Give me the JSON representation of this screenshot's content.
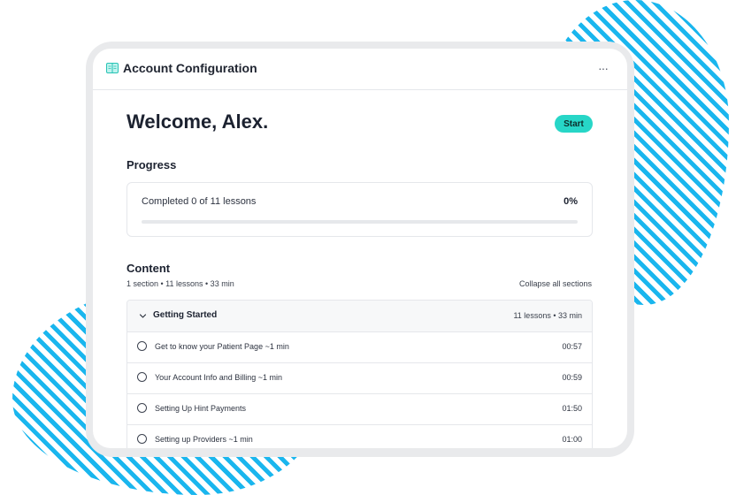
{
  "header": {
    "title": "Account Configuration",
    "book_icon": "book-icon",
    "more_icon": "more-horizontal-icon",
    "more_label": "···"
  },
  "welcome": {
    "heading": "Welcome, Alex.",
    "start_label": "Start"
  },
  "progress": {
    "heading": "Progress",
    "text": "Completed 0 of 11 lessons",
    "percent_label": "0%",
    "percent_value": 0
  },
  "content": {
    "heading": "Content",
    "meta": "1 section • 11 lessons • 33 min",
    "collapse_label": "Collapse all sections",
    "section": {
      "title": "Getting Started",
      "meta": "11 lessons • 33 min",
      "lessons": [
        {
          "title": "Get to know your Patient Page ~1 min",
          "duration": "00:57"
        },
        {
          "title": "Your Account Info and Billing ~1 min",
          "duration": "00:59"
        },
        {
          "title": "Setting Up Hint Payments",
          "duration": "01:50"
        },
        {
          "title": "Setting up Providers ~1 min",
          "duration": "01:00"
        }
      ]
    }
  },
  "colors": {
    "accent": "#27d6c7",
    "decoration": "#1ab6ee",
    "frame": "#e9eaec"
  }
}
